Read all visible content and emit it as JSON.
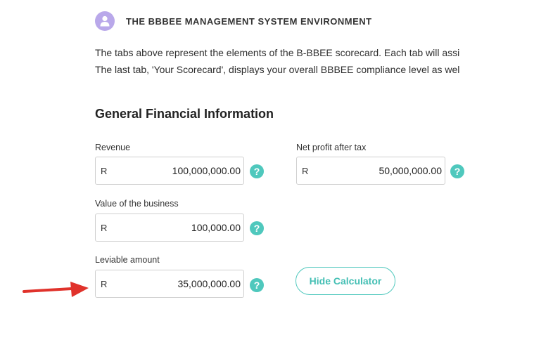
{
  "header": {
    "title": "THE BBBEE MANAGEMENT SYSTEM ENVIRONMENT",
    "icon": "user-icon"
  },
  "intro": {
    "line1": "The tabs above represent the elements of the B-BBEE scorecard. Each tab will assi",
    "line2": "The last tab, 'Your Scorecard', displays your overall BBBEE compliance level as wel"
  },
  "section": {
    "title": "General Financial Information"
  },
  "fields": {
    "revenue": {
      "label": "Revenue",
      "currency": "R",
      "value": "100,000,000.00"
    },
    "net_profit": {
      "label": "Net profit after tax",
      "currency": "R",
      "value": "50,000,000.00"
    },
    "business_value": {
      "label": "Value of the business",
      "currency": "R",
      "value": "100,000.00"
    },
    "leviable": {
      "label": "Leviable amount",
      "currency": "R",
      "value": "35,000,000.00"
    }
  },
  "help": {
    "glyph": "?"
  },
  "buttons": {
    "hide_calculator": "Hide Calculator"
  },
  "colors": {
    "accent": "#4fc8bd",
    "icon_bg": "#b9a8ea",
    "arrow": "#e0322b"
  }
}
